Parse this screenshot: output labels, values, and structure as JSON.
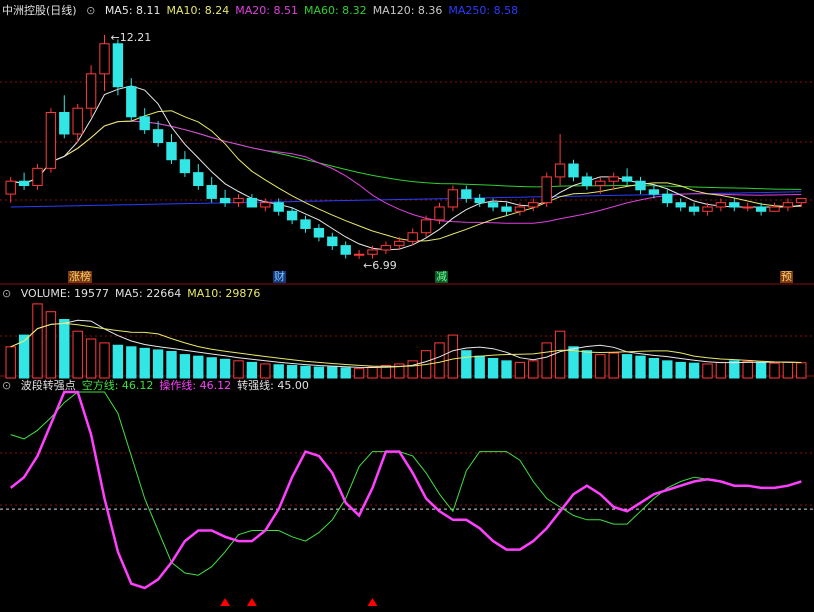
{
  "colors": {
    "up": "#ff3b3b",
    "down": "#33e6e6",
    "ma5": "#e8e8e8",
    "ma10": "#e8e86a",
    "ma20": "#e040e0",
    "ma60": "#30d030",
    "ma120": "#c8c8c8",
    "ma250": "#2a3cff",
    "short_line": "#40e040",
    "op_line": "#ff40ff",
    "strong": "#d8d8d8",
    "grid": "#8a1010",
    "arrow": "#ff0000"
  },
  "price_header": {
    "title": "中洲控股(日线)",
    "items": [
      {
        "label": "MA5: 8.11",
        "color": "#e8e8e8"
      },
      {
        "label": "MA10: 8.24",
        "color": "#e8e86a"
      },
      {
        "label": "MA20: 8.51",
        "color": "#e040e0"
      },
      {
        "label": "MA60: 8.32",
        "color": "#30d030"
      },
      {
        "label": "MA120: 8.36",
        "color": "#c8c8c8"
      },
      {
        "label": "MA250: 8.58",
        "color": "#2a3cff"
      }
    ]
  },
  "volume_header": {
    "items": [
      {
        "label": "VOLUME: 19577",
        "color": "#e0e0e0"
      },
      {
        "label": "MA5: 22664",
        "color": "#e0e0e0"
      },
      {
        "label": "MA10: 29876",
        "color": "#e8e86a"
      }
    ]
  },
  "osc_header": {
    "items": [
      {
        "label": "波段转强点",
        "color": "#e0e0e0"
      },
      {
        "label": "空方线: 46.12",
        "color": "#40e040"
      },
      {
        "label": "操作线: 46.12",
        "color": "#ff40ff"
      },
      {
        "label": "转强线: 45.00",
        "color": "#e0e0e0"
      }
    ]
  },
  "annotations": {
    "high": "12.21",
    "low": "6.99",
    "events": [
      {
        "text": "涨榜",
        "bg": "#7a3a10",
        "color": "#ffd070"
      },
      {
        "text": "财",
        "bg": "#103a7a",
        "color": "#80c0ff"
      },
      {
        "text": "减",
        "bg": "#0a5a2a",
        "color": "#70ff90"
      },
      {
        "text": "预",
        "bg": "#7a3a10",
        "color": "#ffd070"
      }
    ]
  },
  "chart_data": [
    {
      "type": "candlestick",
      "title": "中洲控股(日线)",
      "price_range": [
        6.5,
        12.6
      ],
      "series_ma": [
        "MA5",
        "MA10",
        "MA20",
        "MA60",
        "MA120",
        "MA250"
      ],
      "ohlc": [
        [
          8.5,
          8.9,
          8.3,
          8.8
        ],
        [
          8.8,
          9.0,
          8.6,
          8.7
        ],
        [
          8.7,
          9.2,
          8.6,
          9.1
        ],
        [
          9.1,
          10.5,
          9.0,
          10.4
        ],
        [
          10.4,
          10.8,
          9.8,
          9.9
        ],
        [
          9.9,
          10.6,
          9.7,
          10.5
        ],
        [
          10.5,
          11.5,
          10.3,
          11.3
        ],
        [
          11.3,
          12.21,
          10.9,
          12.0
        ],
        [
          12.0,
          12.1,
          10.8,
          11.0
        ],
        [
          11.0,
          11.2,
          10.2,
          10.3
        ],
        [
          10.3,
          10.5,
          9.9,
          10.0
        ],
        [
          10.0,
          10.2,
          9.6,
          9.7
        ],
        [
          9.7,
          9.9,
          9.2,
          9.3
        ],
        [
          9.3,
          9.5,
          8.9,
          9.0
        ],
        [
          9.0,
          9.2,
          8.6,
          8.7
        ],
        [
          8.7,
          8.9,
          8.3,
          8.4
        ],
        [
          8.4,
          8.6,
          8.2,
          8.3
        ],
        [
          8.3,
          8.5,
          8.2,
          8.4
        ],
        [
          8.4,
          8.5,
          8.2,
          8.2
        ],
        [
          8.2,
          8.4,
          8.1,
          8.3
        ],
        [
          8.3,
          8.4,
          8.0,
          8.1
        ],
        [
          8.1,
          8.2,
          7.8,
          7.9
        ],
        [
          7.9,
          8.0,
          7.6,
          7.7
        ],
        [
          7.7,
          7.8,
          7.4,
          7.5
        ],
        [
          7.5,
          7.6,
          7.2,
          7.3
        ],
        [
          7.3,
          7.4,
          7.0,
          7.1
        ],
        [
          7.1,
          7.2,
          6.99,
          7.1
        ],
        [
          7.1,
          7.3,
          7.0,
          7.2
        ],
        [
          7.2,
          7.4,
          7.1,
          7.3
        ],
        [
          7.3,
          7.5,
          7.2,
          7.4
        ],
        [
          7.4,
          7.7,
          7.3,
          7.6
        ],
        [
          7.6,
          8.0,
          7.5,
          7.9
        ],
        [
          7.9,
          8.3,
          7.8,
          8.2
        ],
        [
          8.2,
          8.7,
          8.1,
          8.6
        ],
        [
          8.6,
          8.7,
          8.3,
          8.4
        ],
        [
          8.4,
          8.5,
          8.2,
          8.3
        ],
        [
          8.3,
          8.4,
          8.1,
          8.2
        ],
        [
          8.2,
          8.3,
          8.0,
          8.1
        ],
        [
          8.1,
          8.3,
          8.0,
          8.2
        ],
        [
          8.2,
          8.4,
          8.1,
          8.3
        ],
        [
          8.3,
          9.0,
          8.2,
          8.9
        ],
        [
          8.9,
          9.9,
          8.7,
          9.2
        ],
        [
          9.2,
          9.3,
          8.8,
          8.9
        ],
        [
          8.9,
          9.0,
          8.6,
          8.7
        ],
        [
          8.7,
          8.9,
          8.5,
          8.8
        ],
        [
          8.8,
          9.0,
          8.6,
          8.9
        ],
        [
          8.9,
          9.1,
          8.7,
          8.8
        ],
        [
          8.8,
          8.9,
          8.5,
          8.6
        ],
        [
          8.6,
          8.7,
          8.4,
          8.5
        ],
        [
          8.5,
          8.6,
          8.2,
          8.3
        ],
        [
          8.3,
          8.4,
          8.1,
          8.2
        ],
        [
          8.2,
          8.3,
          8.0,
          8.1
        ],
        [
          8.1,
          8.3,
          8.0,
          8.2
        ],
        [
          8.2,
          8.4,
          8.1,
          8.3
        ],
        [
          8.3,
          8.4,
          8.1,
          8.2
        ],
        [
          8.2,
          8.3,
          8.1,
          8.2
        ],
        [
          8.2,
          8.3,
          8.0,
          8.1
        ],
        [
          8.1,
          8.3,
          8.1,
          8.2
        ],
        [
          8.2,
          8.4,
          8.1,
          8.3
        ],
        [
          8.3,
          8.4,
          8.2,
          8.4
        ]
      ],
      "annotations": [
        "12.21",
        "6.99"
      ]
    },
    {
      "type": "bar",
      "title": "VOLUME",
      "values": [
        40,
        55,
        95,
        85,
        75,
        60,
        50,
        45,
        42,
        40,
        38,
        36,
        34,
        30,
        28,
        26,
        24,
        22,
        20,
        18,
        17,
        16,
        15,
        14,
        14,
        13,
        12,
        14,
        16,
        18,
        22,
        35,
        45,
        55,
        35,
        28,
        25,
        22,
        20,
        22,
        45,
        60,
        40,
        35,
        30,
        32,
        30,
        28,
        25,
        22,
        20,
        19,
        18,
        20,
        22,
        21,
        20,
        19,
        20,
        19.5
      ]
    },
    {
      "type": "line",
      "title": "波段转强点",
      "series": [
        {
          "name": "空方线",
          "values": [
            80,
            78,
            82,
            88,
            95,
            100,
            100,
            100,
            90,
            70,
            50,
            35,
            20,
            15,
            14,
            18,
            25,
            33,
            35,
            35,
            35,
            32,
            30,
            34,
            40,
            50,
            65,
            72,
            72,
            72,
            70,
            62,
            52,
            44,
            63,
            72,
            72,
            72,
            68,
            58,
            50,
            46,
            42,
            40,
            40,
            38,
            38,
            44,
            50,
            55,
            58,
            60,
            59,
            58,
            56,
            56,
            55,
            55,
            56,
            58
          ]
        },
        {
          "name": "操作线",
          "values": [
            55,
            60,
            70,
            85,
            100,
            100,
            80,
            50,
            25,
            10,
            8,
            12,
            20,
            30,
            35,
            35,
            32,
            30,
            30,
            35,
            45,
            60,
            72,
            70,
            62,
            48,
            42,
            55,
            72,
            72,
            62,
            50,
            44,
            40,
            40,
            36,
            30,
            26,
            26,
            30,
            36,
            44,
            52,
            56,
            52,
            46,
            44,
            48,
            52,
            54,
            56,
            58,
            59,
            58,
            56,
            56,
            55,
            55,
            56,
            58
          ]
        },
        {
          "name": "转强线",
          "values": [
            45,
            45,
            45,
            45,
            45,
            45,
            45,
            45,
            45,
            45,
            45,
            45,
            45,
            45,
            45,
            45,
            45,
            45,
            45,
            45,
            45,
            45,
            45,
            45,
            45,
            45,
            45,
            45,
            45,
            45,
            45,
            45,
            45,
            45,
            45,
            45,
            45,
            45,
            45,
            45,
            45,
            45,
            45,
            45,
            45,
            45,
            45,
            45,
            45,
            45,
            45,
            45,
            45,
            45,
            45,
            45,
            45,
            45,
            45,
            45
          ]
        }
      ]
    }
  ]
}
